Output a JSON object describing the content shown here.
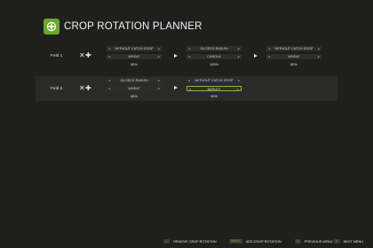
{
  "header": {
    "title": "CROP ROTATION PLANNER",
    "logo_icon": "farm-planner-icon",
    "accent": "#6aa72b"
  },
  "fields": [
    {
      "name": "Feld 1",
      "slots": [
        {
          "catch_crop": "WITHOUT CATCH CROP",
          "crop": "WHEAT",
          "yield": "65%"
        },
        {
          "catch_crop": "OILSEED RADISH",
          "crop": "CANOLA",
          "yield": "105%"
        },
        {
          "catch_crop": "WITHOUT CATCH CROP",
          "crop": "WHEAT",
          "yield": "80%"
        }
      ]
    },
    {
      "name": "Feld 5",
      "slots": [
        {
          "catch_crop": "OILSEED RADISH",
          "crop": "WHEAT",
          "yield": "65%"
        },
        {
          "catch_crop": "WITHOUT CATCH CROP",
          "crop": "BARLEY",
          "yield": "90%"
        }
      ]
    }
  ],
  "footer": {
    "remove": {
      "key": "—",
      "label": "REMOVE CROP ROTATION"
    },
    "add": {
      "key": "SPACE",
      "label": "ADD CROP ROTATION"
    },
    "prev": {
      "key": "⊙",
      "label": "PREVIOUS MENU"
    },
    "next": {
      "key": "⊙",
      "label": "NEXT MENU"
    }
  }
}
